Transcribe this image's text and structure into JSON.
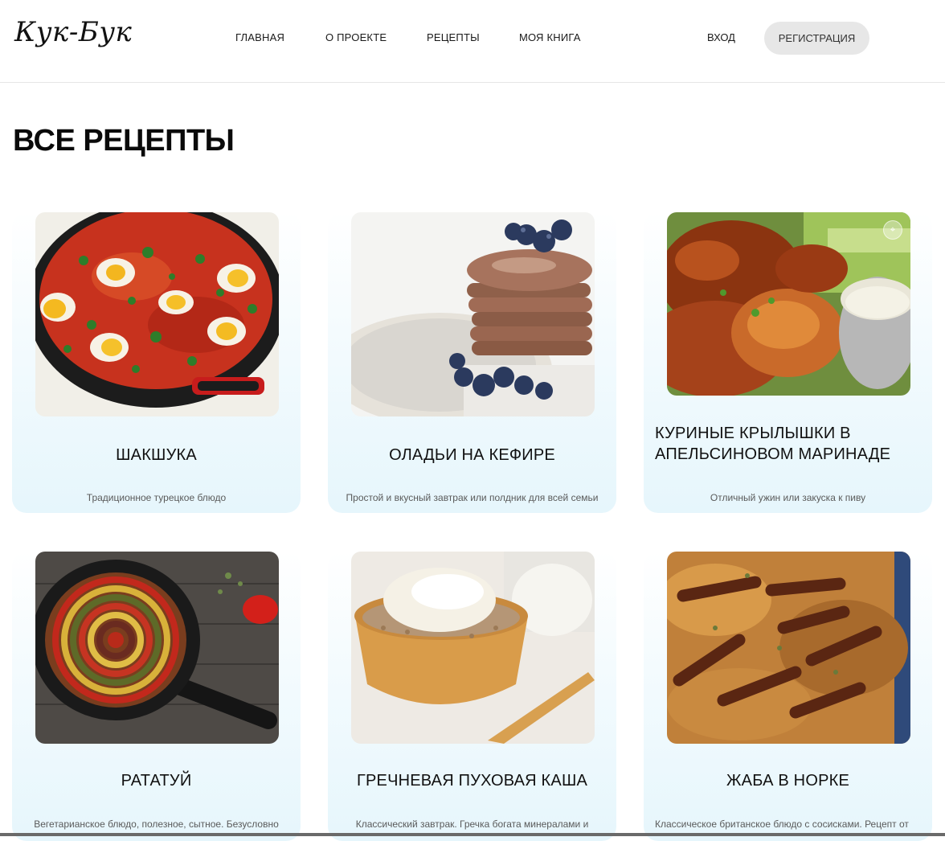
{
  "header": {
    "logo": "Кук-Бук",
    "nav": [
      "ГЛАВНАЯ",
      "О ПРОЕКТЕ",
      "РЕЦЕПТЫ",
      "МОЯ КНИГА"
    ],
    "login": "ВХОД",
    "register": "РЕГИСТРАЦИЯ"
  },
  "page": {
    "title": "ВСЕ РЕЦЕПТЫ"
  },
  "recipes": [
    {
      "title": "ШАКШУКА",
      "description": "Традиционное турецкое блюдо",
      "image_icon": "shakshuka-image"
    },
    {
      "title": "ОЛАДЬИ НА КЕФИРЕ",
      "description": "Простой и вкусный завтрак или полдник для всей семьи",
      "image_icon": "pancakes-image"
    },
    {
      "title": "КУРИНЫЕ КРЫЛЫШКИ В АПЕЛЬСИНОВОМ МАРИНАДЕ",
      "description": "Отличный ужин или закуска к пиву",
      "image_icon": "chicken-wings-image"
    },
    {
      "title": "РАТАТУЙ",
      "description": "Вегетарианское блюдо, полезное, сытное. Безусловно",
      "image_icon": "ratatouille-image"
    },
    {
      "title": "ГРЕЧНЕВАЯ ПУХОВАЯ КАША",
      "description": "Классический завтрак. Гречка богата минералами и",
      "image_icon": "buckwheat-image"
    },
    {
      "title": "ЖАБА В НОРКЕ",
      "description": "Классическое британское блюдо с сосисками. Рецепт от",
      "image_icon": "toad-in-the-hole-image"
    }
  ]
}
